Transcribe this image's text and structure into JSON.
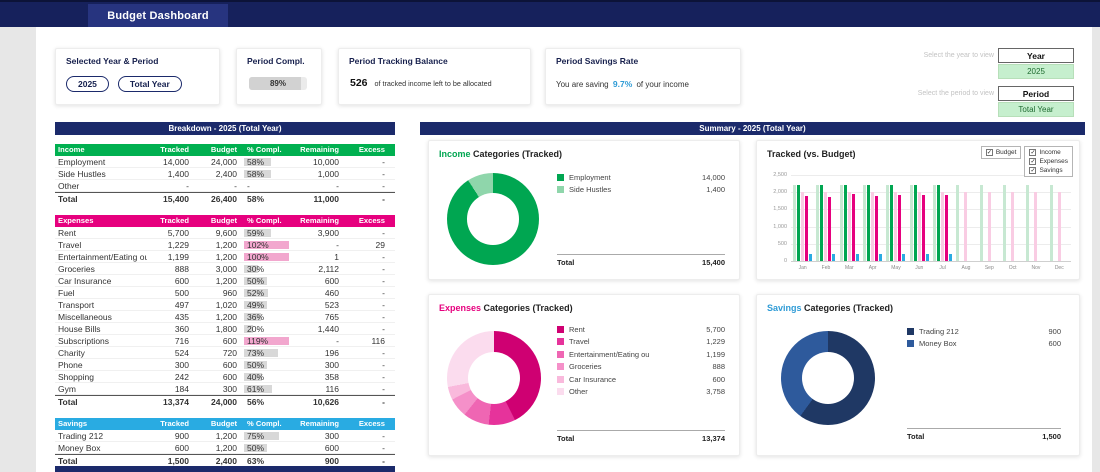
{
  "theme": {
    "navy": "#16215c",
    "navy2": "#27347f",
    "headerbar": "#1b2a6b",
    "good": "#c6efce",
    "income_accent": "#00a651",
    "expenses_accent": "#e6007e",
    "savings_accent": "#2e9bd6"
  },
  "header": {
    "title": "Budget Dashboard"
  },
  "kpis": {
    "selector": {
      "label": "Selected Year & Period",
      "year_button": "2025",
      "period_button": "Total Year"
    },
    "completion": {
      "label": "Period Compl.",
      "value": "89%",
      "pct_num": 89
    },
    "balance": {
      "label": "Period Tracking Balance",
      "value": "526",
      "caption": "of tracked income left to be allocated"
    },
    "savings_rate": {
      "label": "Period Savings Rate",
      "prefix": "You are saving",
      "value": "9.7%",
      "suffix": "of your income"
    }
  },
  "selectors": {
    "year_hint": "Select the year to view",
    "year_label": "Year",
    "year_value": "2025",
    "period_hint": "Select the period to view",
    "period_label": "Period",
    "period_value": "Total Year"
  },
  "breakdown": {
    "title": "Breakdown - 2025 (Total Year)",
    "sections": [
      {
        "name": "Income",
        "color": "#00b050",
        "columns": [
          "Tracked",
          "Budget",
          "% Compl.",
          "Remaining",
          "Excess"
        ],
        "rows": [
          {
            "label": "Employment",
            "tracked": "14,000",
            "budget": "24,000",
            "pct": "58%",
            "pct_num": 58,
            "remaining": "10,000",
            "excess": "-"
          },
          {
            "label": "Side Hustles",
            "tracked": "1,400",
            "budget": "2,400",
            "pct": "58%",
            "pct_num": 58,
            "remaining": "1,000",
            "excess": "-"
          },
          {
            "label": "Other",
            "tracked": "-",
            "budget": "-",
            "pct": "-",
            "pct_num": 0,
            "remaining": "-",
            "excess": "-"
          }
        ],
        "total": {
          "label": "Total",
          "tracked": "15,400",
          "budget": "26,400",
          "pct": "58%",
          "pct_num": 58,
          "remaining": "11,000",
          "excess": "-"
        }
      },
      {
        "name": "Expenses",
        "color": "#e6007e",
        "columns": [
          "Tracked",
          "Budget",
          "% Compl.",
          "Remaining",
          "Excess"
        ],
        "rows": [
          {
            "label": "Rent",
            "tracked": "5,700",
            "budget": "9,600",
            "pct": "59%",
            "pct_num": 59,
            "remaining": "3,900",
            "excess": "-"
          },
          {
            "label": "Travel",
            "tracked": "1,229",
            "budget": "1,200",
            "pct": "102%",
            "pct_num": 102,
            "remaining": "-",
            "excess": "29"
          },
          {
            "label": "Entertainment/Eating ou",
            "tracked": "1,199",
            "budget": "1,200",
            "pct": "100%",
            "pct_num": 100,
            "remaining": "1",
            "excess": "-"
          },
          {
            "label": "Groceries",
            "tracked": "888",
            "budget": "3,000",
            "pct": "30%",
            "pct_num": 30,
            "remaining": "2,112",
            "excess": "-"
          },
          {
            "label": "Car Insurance",
            "tracked": "600",
            "budget": "1,200",
            "pct": "50%",
            "pct_num": 50,
            "remaining": "600",
            "excess": "-"
          },
          {
            "label": "Fuel",
            "tracked": "500",
            "budget": "960",
            "pct": "52%",
            "pct_num": 52,
            "remaining": "460",
            "excess": "-"
          },
          {
            "label": "Transport",
            "tracked": "497",
            "budget": "1,020",
            "pct": "49%",
            "pct_num": 49,
            "remaining": "523",
            "excess": "-"
          },
          {
            "label": "Miscellaneous",
            "tracked": "435",
            "budget": "1,200",
            "pct": "36%",
            "pct_num": 36,
            "remaining": "765",
            "excess": "-"
          },
          {
            "label": "House Bills",
            "tracked": "360",
            "budget": "1,800",
            "pct": "20%",
            "pct_num": 20,
            "remaining": "1,440",
            "excess": "-"
          },
          {
            "label": "Subscriptions",
            "tracked": "716",
            "budget": "600",
            "pct": "119%",
            "pct_num": 119,
            "remaining": "-",
            "excess": "116"
          },
          {
            "label": "Charity",
            "tracked": "524",
            "budget": "720",
            "pct": "73%",
            "pct_num": 73,
            "remaining": "196",
            "excess": "-"
          },
          {
            "label": "Phone",
            "tracked": "300",
            "budget": "600",
            "pct": "50%",
            "pct_num": 50,
            "remaining": "300",
            "excess": "-"
          },
          {
            "label": "Shopping",
            "tracked": "242",
            "budget": "600",
            "pct": "40%",
            "pct_num": 40,
            "remaining": "358",
            "excess": "-"
          },
          {
            "label": "Gym",
            "tracked": "184",
            "budget": "300",
            "pct": "61%",
            "pct_num": 61,
            "remaining": "116",
            "excess": "-"
          }
        ],
        "total": {
          "label": "Total",
          "tracked": "13,374",
          "budget": "24,000",
          "pct": "56%",
          "pct_num": 56,
          "remaining": "10,626",
          "excess": "-"
        }
      },
      {
        "name": "Savings",
        "color": "#29abe2",
        "columns": [
          "Tracked",
          "Budget",
          "% Compl.",
          "Remaining",
          "Excess"
        ],
        "rows": [
          {
            "label": "Trading 212",
            "tracked": "900",
            "budget": "1,200",
            "pct": "75%",
            "pct_num": 75,
            "remaining": "300",
            "excess": "-"
          },
          {
            "label": "Money Box",
            "tracked": "600",
            "budget": "1,200",
            "pct": "50%",
            "pct_num": 50,
            "remaining": "600",
            "excess": "-"
          }
        ],
        "total": {
          "label": "Total",
          "tracked": "1,500",
          "budget": "2,400",
          "pct": "63%",
          "pct_num": 63,
          "remaining": "900",
          "excess": "-"
        }
      }
    ]
  },
  "summary": {
    "title": "Summary - 2025 (Total Year)",
    "chart_filters": [
      "Budget",
      "Income",
      "Expenses",
      "Savings"
    ]
  },
  "chart_data": [
    {
      "type": "pie",
      "title_accent": "Income",
      "title_rest": " Categories (Tracked)",
      "accent_color": "#00a651",
      "labels": [
        "Employment",
        "Side Hustles"
      ],
      "values": [
        14000,
        1400
      ],
      "colors": [
        "#00a651",
        "#8fd6ab"
      ],
      "total_label": "Total",
      "total": 15400,
      "legend_position": "right"
    },
    {
      "type": "bar",
      "title": "Tracked (vs. Budget)",
      "x": [
        "Jan",
        "Feb",
        "Mar",
        "Apr",
        "May",
        "Jun",
        "Jul",
        "Aug",
        "Sep",
        "Oct",
        "Nov",
        "Dec"
      ],
      "series": [
        {
          "name": "Income Budget",
          "color": "#c7e8d2",
          "values": [
            2200,
            2200,
            2200,
            2200,
            2200,
            2200,
            2200,
            2200,
            2200,
            2200,
            2200,
            2200
          ]
        },
        {
          "name": "Income",
          "color": "#00a651",
          "values": [
            2200,
            2200,
            2200,
            2200,
            2200,
            2200,
            2200,
            0,
            0,
            0,
            0,
            0
          ]
        },
        {
          "name": "Expenses Budget",
          "color": "#f9cce3",
          "values": [
            2000,
            2000,
            2000,
            2000,
            2000,
            2000,
            2000,
            2000,
            2000,
            2000,
            2000,
            2000
          ]
        },
        {
          "name": "Expenses",
          "color": "#e6007e",
          "values": [
            1900,
            1870,
            1950,
            1880,
            1920,
            1930,
            1924,
            0,
            0,
            0,
            0,
            0
          ]
        },
        {
          "name": "Savings",
          "color": "#29abe2",
          "values": [
            214,
            214,
            214,
            214,
            214,
            214,
            216,
            0,
            0,
            0,
            0,
            0
          ]
        }
      ],
      "ylim": [
        0,
        2500
      ],
      "yticks": [
        0,
        500,
        1000,
        1500,
        2000,
        2500
      ],
      "grid": true,
      "legend_position": "top-right-checkboxes"
    },
    {
      "type": "pie",
      "title_accent": "Expenses",
      "title_rest": " Categories (Tracked)",
      "accent_color": "#e6007e",
      "labels": [
        "Rent",
        "Travel",
        "Entertainment/Eating ou",
        "Groceries",
        "Car Insurance",
        "Other"
      ],
      "values": [
        5700,
        1229,
        1199,
        888,
        600,
        3758
      ],
      "colors": [
        "#cf0072",
        "#e6339b",
        "#ef66b3",
        "#f590c9",
        "#f9b9dc",
        "#fbdcee"
      ],
      "total_label": "Total",
      "total": 13374,
      "legend_position": "right"
    },
    {
      "type": "pie",
      "title_accent": "Savings",
      "title_rest": " Categories (Tracked)",
      "accent_color": "#2e9bd6",
      "labels": [
        "Trading 212",
        "Money Box"
      ],
      "values": [
        900,
        600
      ],
      "colors": [
        "#1f3864",
        "#2e5a9c"
      ],
      "total_label": "Total",
      "total": 1500,
      "legend_position": "right"
    }
  ]
}
